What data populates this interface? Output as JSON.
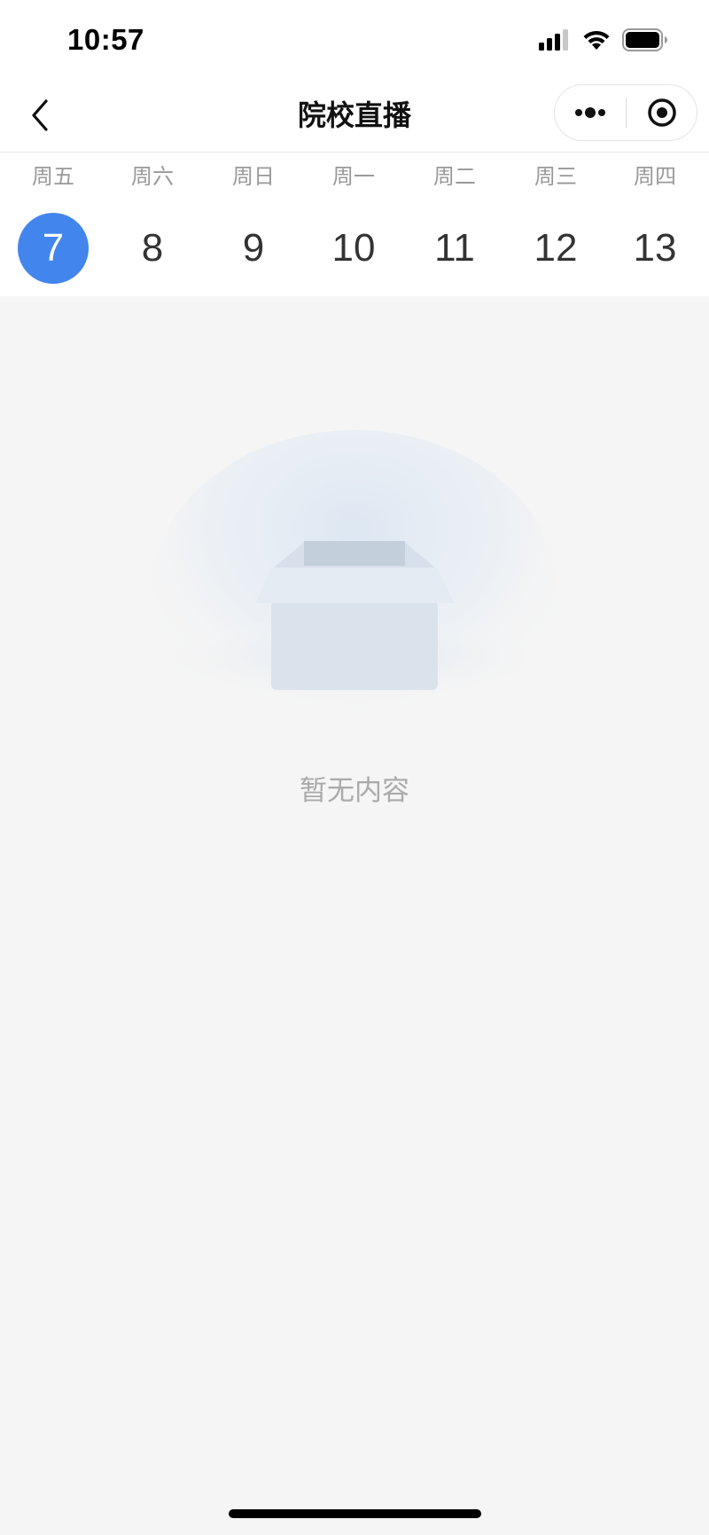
{
  "status_bar": {
    "time": "10:57",
    "icons": [
      "cellular-signal-icon",
      "wifi-icon",
      "battery-icon"
    ]
  },
  "nav": {
    "title": "院校直播",
    "back_icon": "chevron-left-icon",
    "more_icon": "more-dots-icon",
    "close_icon": "target-close-icon"
  },
  "calendar": {
    "days": [
      {
        "weekday": "周五",
        "date": "7",
        "selected": true
      },
      {
        "weekday": "周六",
        "date": "8",
        "selected": false
      },
      {
        "weekday": "周日",
        "date": "9",
        "selected": false
      },
      {
        "weekday": "周一",
        "date": "10",
        "selected": false
      },
      {
        "weekday": "周二",
        "date": "11",
        "selected": false
      },
      {
        "weekday": "周三",
        "date": "12",
        "selected": false
      },
      {
        "weekday": "周四",
        "date": "13",
        "selected": false
      }
    ],
    "accent_color": "#4285ec"
  },
  "empty_state": {
    "icon": "empty-box-icon",
    "text": "暂无内容"
  }
}
